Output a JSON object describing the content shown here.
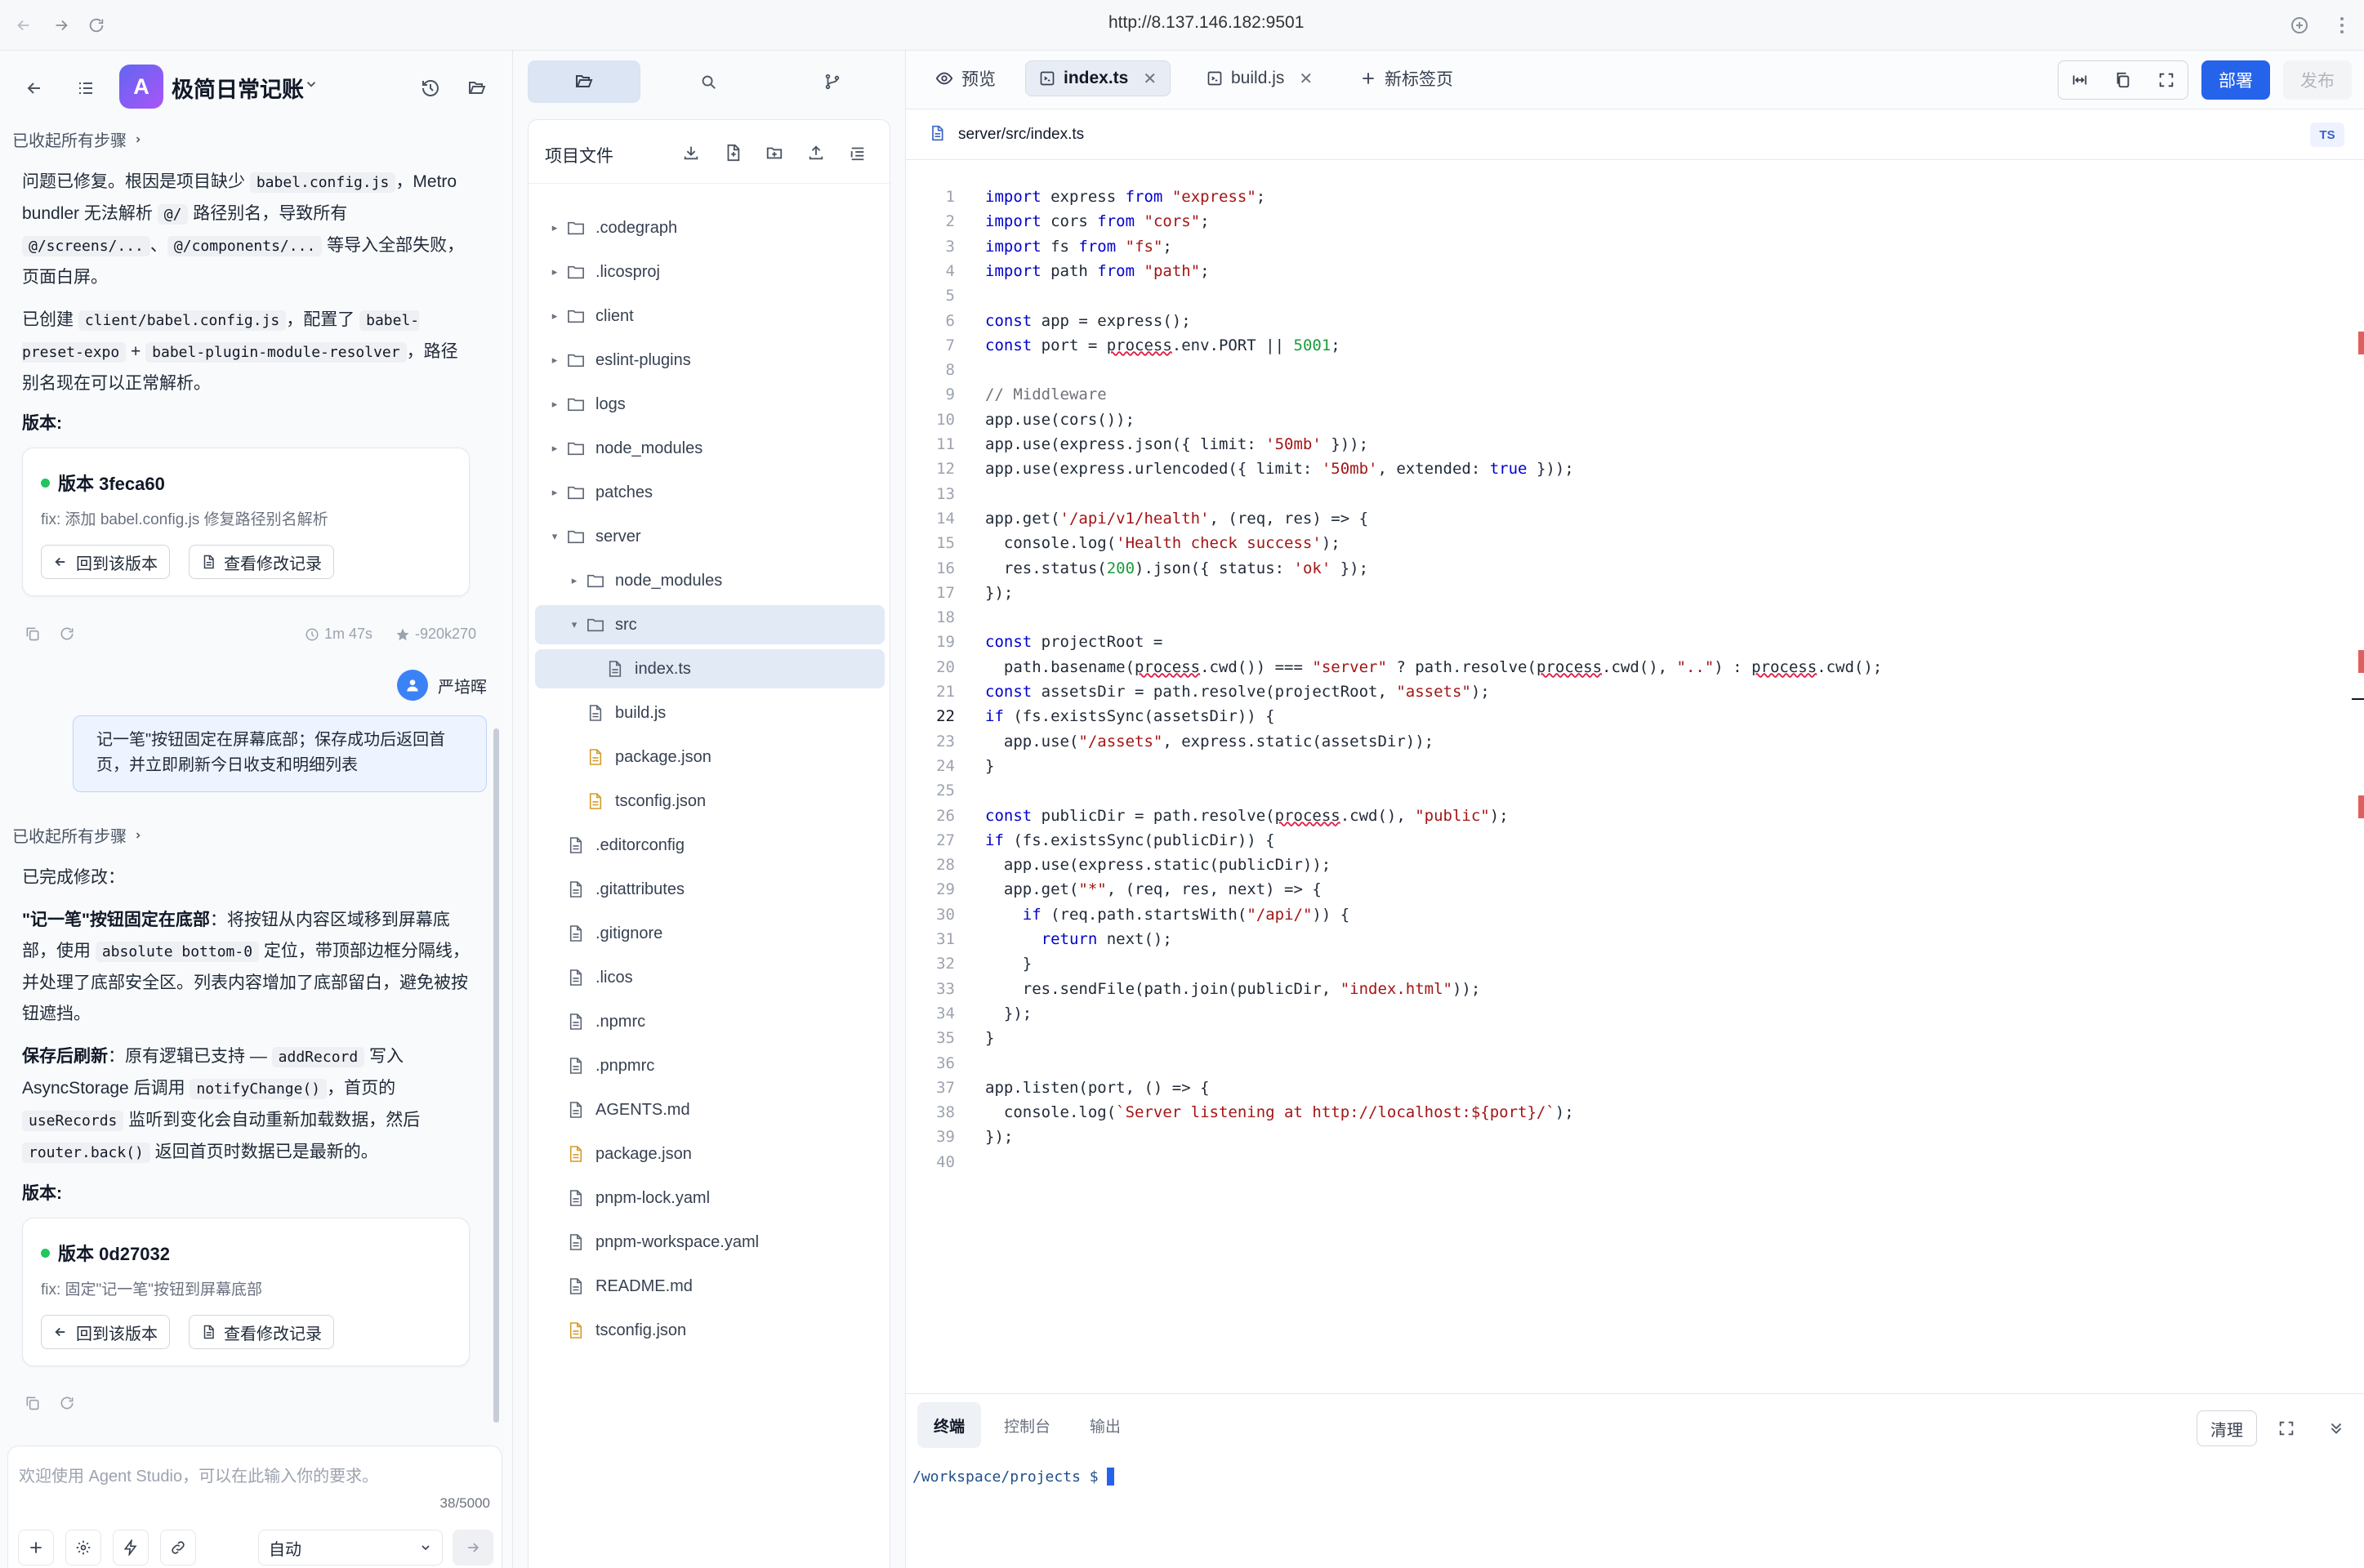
{
  "browser": {
    "url": "http://8.137.146.182:9501"
  },
  "chat": {
    "app_name": "极简日常记账",
    "app_initial": "A",
    "collapsed_label_1": "已收起所有步骤",
    "msg1_p1": [
      "问题已修复。根因是项目缺少 ",
      "babel.config.js",
      "，Metro bundler 无法解析 ",
      "@/",
      " 路径别名，导致所有 ",
      "@/screens/...",
      "、",
      "@/components/...",
      " 等导入全部失败，页面白屏。"
    ],
    "msg1_p2": [
      "已创建 ",
      "client/babel.config.js",
      "，配置了 ",
      "babel-preset-expo",
      " + ",
      "babel-plugin-module-resolver",
      "，路径别名现在可以正常解析。"
    ],
    "version_label": "版本:",
    "version1": {
      "title": "版本 3feca60",
      "message": "fix: 添加 babel.config.js 修复路径别名解析"
    },
    "revert_label": "回到该版本",
    "view_changes_label": "查看修改记录",
    "meta1": {
      "duration": "1m 47s",
      "tokens": "-920k270"
    },
    "user_name": "严培晖",
    "user_message": "记一笔\"按钮固定在屏幕底部；保存成功后返回首页，并立即刷新今日收支和明细列表",
    "collapsed_label_2": "已收起所有步骤",
    "msg2_intro": "已完成修改：",
    "msg2_p1": [
      "\"记一笔\"按钮固定在底部",
      "：将按钮从内容区域移到屏幕底部，使用 ",
      "absolute bottom-0",
      " 定位，带顶部边框分隔线，并处理了底部安全区。列表内容增加了底部留白，避免被按钮遮挡。"
    ],
    "msg2_p2": [
      "保存后刷新",
      "：原有逻辑已支持 — ",
      "addRecord",
      " 写入 AsyncStorage 后调用 ",
      "notifyChange()",
      "，首页的 ",
      "useRecords",
      " 监听到变化会自动重新加载数据，然后 ",
      "router.back()",
      " 返回首页时数据已是最新的。"
    ],
    "version2": {
      "title": "版本 0d27032",
      "message": "fix: 固定\"记一笔\"按钮到屏幕底部"
    },
    "input": {
      "placeholder": "欢迎使用 Agent Studio，可以在此输入你的要求。",
      "count": "38/5000",
      "mode": "自动"
    }
  },
  "explorer": {
    "title": "项目文件",
    "tree": [
      {
        "name": ".codegraph",
        "type": "folder",
        "depth": 0,
        "open": false
      },
      {
        "name": ".licosproj",
        "type": "folder",
        "depth": 0,
        "open": false
      },
      {
        "name": "client",
        "type": "folder",
        "depth": 0,
        "open": false
      },
      {
        "name": "eslint-plugins",
        "type": "folder",
        "depth": 0,
        "open": false
      },
      {
        "name": "logs",
        "type": "folder",
        "depth": 0,
        "open": false
      },
      {
        "name": "node_modules",
        "type": "folder",
        "depth": 0,
        "open": false
      },
      {
        "name": "patches",
        "type": "folder",
        "depth": 0,
        "open": false
      },
      {
        "name": "server",
        "type": "folder",
        "depth": 0,
        "open": true
      },
      {
        "name": "node_modules",
        "type": "folder",
        "depth": 1,
        "open": false
      },
      {
        "name": "src",
        "type": "folder",
        "depth": 1,
        "open": true,
        "selected": true
      },
      {
        "name": "index.ts",
        "type": "file",
        "depth": 2,
        "selected": true
      },
      {
        "name": "build.js",
        "type": "file",
        "depth": 1
      },
      {
        "name": "package.json",
        "type": "json",
        "depth": 1
      },
      {
        "name": "tsconfig.json",
        "type": "json",
        "depth": 1
      },
      {
        "name": ".editorconfig",
        "type": "file",
        "depth": 0
      },
      {
        "name": ".gitattributes",
        "type": "file",
        "depth": 0
      },
      {
        "name": ".gitignore",
        "type": "file",
        "depth": 0
      },
      {
        "name": ".licos",
        "type": "file",
        "depth": 0
      },
      {
        "name": ".npmrc",
        "type": "file",
        "depth": 0
      },
      {
        "name": ".pnpmrc",
        "type": "file",
        "depth": 0
      },
      {
        "name": "AGENTS.md",
        "type": "file",
        "depth": 0
      },
      {
        "name": "package.json",
        "type": "json",
        "depth": 0
      },
      {
        "name": "pnpm-lock.yaml",
        "type": "file",
        "depth": 0
      },
      {
        "name": "pnpm-workspace.yaml",
        "type": "file",
        "depth": 0
      },
      {
        "name": "README.md",
        "type": "file",
        "depth": 0
      },
      {
        "name": "tsconfig.json",
        "type": "json",
        "depth": 0
      }
    ]
  },
  "editor": {
    "tabs": {
      "preview": "预览",
      "file1": "index.ts",
      "file2": "build.js",
      "new_tab": "新标签页"
    },
    "deploy_label": "部署",
    "publish_label": "发布",
    "path": "server/src/index.ts",
    "lang_badge": "TS",
    "current_line": 22,
    "code_lines": [
      "import express from \"express\";",
      "import cors from \"cors\";",
      "import fs from \"fs\";",
      "import path from \"path\";",
      "",
      "const app = express();",
      "const port = process.env.PORT || 5001;",
      "",
      "// Middleware",
      "app.use(cors());",
      "app.use(express.json({ limit: '50mb' }));",
      "app.use(express.urlencoded({ limit: '50mb', extended: true }));",
      "",
      "app.get('/api/v1/health', (req, res) => {",
      "  console.log('Health check success');",
      "  res.status(200).json({ status: 'ok' });",
      "});",
      "",
      "const projectRoot =",
      "  path.basename(process.cwd()) === \"server\" ? path.resolve(process.cwd(), \"..\") : process.cwd();",
      "const assetsDir = path.resolve(projectRoot, \"assets\");",
      "if (fs.existsSync(assetsDir)) {",
      "  app.use(\"/assets\", express.static(assetsDir));",
      "}",
      "",
      "const publicDir = path.resolve(process.cwd(), \"public\");",
      "if (fs.existsSync(publicDir)) {",
      "  app.use(express.static(publicDir));",
      "  app.get(\"*\", (req, res, next) => {",
      "    if (req.path.startsWith(\"/api/\")) {",
      "      return next();",
      "    }",
      "    res.sendFile(path.join(publicDir, \"index.html\"));",
      "  });",
      "}",
      "",
      "app.listen(port, () => {",
      "  console.log(`Server listening at http://localhost:${port}/`);",
      "});",
      ""
    ]
  },
  "terminal": {
    "tabs": [
      "终端",
      "控制台",
      "输出"
    ],
    "clear_label": "清理",
    "prompt": "/workspace/projects $"
  }
}
